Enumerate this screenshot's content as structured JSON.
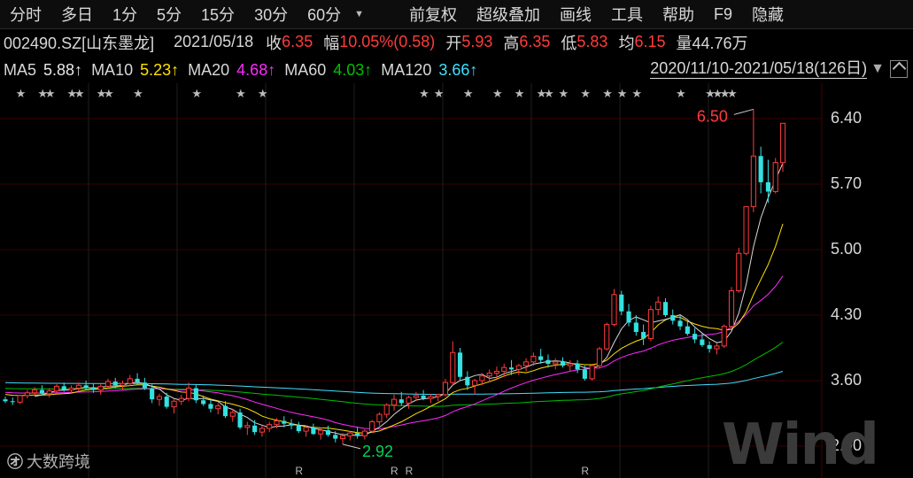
{
  "toolbar": {
    "items": [
      "分时",
      "多日",
      "1分",
      "5分",
      "15分",
      "30分",
      "60分"
    ],
    "arrow": "▼",
    "right_items": [
      "前复权",
      "超级叠加",
      "画线",
      "工具",
      "帮助",
      "F9",
      "隐藏"
    ]
  },
  "quote": {
    "code": "002490.SZ[山东墨龙]",
    "date": "2021/05/18",
    "close_label": "收",
    "close": "6.35",
    "change_label": "幅",
    "change_pct": "10.05%",
    "change_abs": "(0.58)",
    "open_label": "开",
    "open": "5.93",
    "high_label": "高",
    "high": "6.35",
    "low_label": "低",
    "low": "5.83",
    "avg_label": "均",
    "avg": "6.15",
    "vol_label": "量",
    "vol": "44.76万"
  },
  "ma": {
    "ma5_label": "MA5",
    "ma5": "5.88↑",
    "ma10_label": "MA10",
    "ma10": "5.23↑",
    "ma20_label": "MA20",
    "ma20": "4.68↑",
    "ma60_label": "MA60",
    "ma60": "4.03↑",
    "ma120_label": "MA120",
    "ma120": "3.66↑"
  },
  "range": "2020/11/10-2021/05/18(126日)",
  "range_arrow": "▼",
  "colors": {
    "up": "#ff3b3b",
    "down": "#34e0e0",
    "ma5": "#d8d8d8",
    "ma10": "#ffe000",
    "ma20": "#ff2aff",
    "ma60": "#00c000",
    "ma120": "#40e0ff"
  },
  "logo": {
    "mark": "㋔",
    "text": "大数跨境"
  },
  "watermark": "Wind",
  "chart_data": {
    "type": "candlestick",
    "yticks": [
      "6.40",
      "5.70",
      "5.00",
      "4.30",
      "3.60",
      "2.90"
    ],
    "ylim": [
      2.9,
      6.4
    ],
    "annotations": {
      "max": "6.50",
      "min": "2.92"
    },
    "markers": {
      "star": "★",
      "r": "R"
    },
    "ohlc": [
      [
        3.4,
        3.43,
        3.36,
        3.38
      ],
      [
        3.38,
        3.42,
        3.34,
        3.37
      ],
      [
        3.37,
        3.45,
        3.35,
        3.44
      ],
      [
        3.44,
        3.5,
        3.41,
        3.47
      ],
      [
        3.47,
        3.53,
        3.44,
        3.5
      ],
      [
        3.5,
        3.55,
        3.44,
        3.46
      ],
      [
        3.46,
        3.52,
        3.42,
        3.49
      ],
      [
        3.49,
        3.56,
        3.46,
        3.54
      ],
      [
        3.54,
        3.58,
        3.48,
        3.5
      ],
      [
        3.5,
        3.55,
        3.46,
        3.52
      ],
      [
        3.52,
        3.58,
        3.48,
        3.55
      ],
      [
        3.55,
        3.6,
        3.5,
        3.53
      ],
      [
        3.53,
        3.57,
        3.47,
        3.5
      ],
      [
        3.5,
        3.56,
        3.45,
        3.54
      ],
      [
        3.54,
        3.62,
        3.51,
        3.59
      ],
      [
        3.59,
        3.63,
        3.52,
        3.55
      ],
      [
        3.55,
        3.6,
        3.5,
        3.57
      ],
      [
        3.57,
        3.66,
        3.54,
        3.62
      ],
      [
        3.62,
        3.68,
        3.55,
        3.58
      ],
      [
        3.58,
        3.63,
        3.5,
        3.52
      ],
      [
        3.52,
        3.56,
        3.36,
        3.4
      ],
      [
        3.4,
        3.46,
        3.33,
        3.43
      ],
      [
        3.43,
        3.47,
        3.3,
        3.32
      ],
      [
        3.32,
        3.4,
        3.25,
        3.38
      ],
      [
        3.38,
        3.45,
        3.34,
        3.41
      ],
      [
        3.41,
        3.58,
        3.38,
        3.52
      ],
      [
        3.52,
        3.56,
        3.36,
        3.39
      ],
      [
        3.39,
        3.44,
        3.33,
        3.35
      ],
      [
        3.35,
        3.4,
        3.26,
        3.3
      ],
      [
        3.3,
        3.36,
        3.24,
        3.33
      ],
      [
        3.33,
        3.38,
        3.2,
        3.22
      ],
      [
        3.22,
        3.3,
        3.16,
        3.26
      ],
      [
        3.26,
        3.3,
        3.08,
        3.1
      ],
      [
        3.1,
        3.16,
        3.02,
        3.12
      ],
      [
        3.12,
        3.18,
        3.02,
        3.05
      ],
      [
        3.05,
        3.12,
        3.0,
        3.09
      ],
      [
        3.09,
        3.16,
        3.05,
        3.13
      ],
      [
        3.13,
        3.2,
        3.09,
        3.17
      ],
      [
        3.17,
        3.22,
        3.1,
        3.14
      ],
      [
        3.14,
        3.19,
        3.08,
        3.12
      ],
      [
        3.12,
        3.16,
        3.04,
        3.06
      ],
      [
        3.06,
        3.12,
        3.0,
        3.1
      ],
      [
        3.1,
        3.14,
        3.02,
        3.03
      ],
      [
        3.03,
        3.1,
        2.97,
        3.07
      ],
      [
        3.07,
        3.12,
        3.0,
        3.02
      ],
      [
        3.02,
        3.06,
        2.94,
        2.98
      ],
      [
        2.98,
        3.04,
        2.92,
        3.01
      ],
      [
        3.01,
        3.06,
        2.96,
        3.04
      ],
      [
        3.04,
        3.1,
        2.98,
        3.01
      ],
      [
        3.01,
        3.08,
        2.97,
        3.06
      ],
      [
        3.06,
        3.18,
        3.04,
        3.16
      ],
      [
        3.16,
        3.26,
        3.12,
        3.24
      ],
      [
        3.24,
        3.36,
        3.2,
        3.34
      ],
      [
        3.34,
        3.45,
        3.28,
        3.4
      ],
      [
        3.4,
        3.48,
        3.33,
        3.36
      ],
      [
        3.36,
        3.44,
        3.3,
        3.42
      ],
      [
        3.42,
        3.48,
        3.38,
        3.44
      ],
      [
        3.44,
        3.5,
        3.39,
        3.41
      ],
      [
        3.41,
        3.46,
        3.36,
        3.43
      ],
      [
        3.43,
        3.46,
        3.38,
        3.45
      ],
      [
        3.45,
        3.62,
        3.43,
        3.58
      ],
      [
        3.58,
        4.02,
        3.55,
        3.9
      ],
      [
        3.9,
        3.95,
        3.6,
        3.64
      ],
      [
        3.64,
        3.7,
        3.5,
        3.55
      ],
      [
        3.55,
        3.62,
        3.45,
        3.6
      ],
      [
        3.6,
        3.68,
        3.55,
        3.65
      ],
      [
        3.65,
        3.72,
        3.58,
        3.68
      ],
      [
        3.68,
        3.75,
        3.62,
        3.7
      ],
      [
        3.7,
        3.78,
        3.64,
        3.74
      ],
      [
        3.74,
        3.82,
        3.66,
        3.72
      ],
      [
        3.72,
        3.78,
        3.66,
        3.76
      ],
      [
        3.76,
        3.84,
        3.7,
        3.8
      ],
      [
        3.8,
        3.9,
        3.76,
        3.86
      ],
      [
        3.86,
        3.94,
        3.78,
        3.82
      ],
      [
        3.82,
        3.88,
        3.74,
        3.78
      ],
      [
        3.78,
        3.84,
        3.72,
        3.8
      ],
      [
        3.8,
        3.85,
        3.74,
        3.76
      ],
      [
        3.76,
        3.82,
        3.7,
        3.78
      ],
      [
        3.78,
        3.82,
        3.68,
        3.72
      ],
      [
        3.72,
        3.76,
        3.6,
        3.62
      ],
      [
        3.62,
        3.78,
        3.6,
        3.76
      ],
      [
        3.76,
        3.96,
        3.74,
        3.94
      ],
      [
        3.94,
        4.22,
        3.92,
        4.2
      ],
      [
        4.2,
        4.58,
        4.18,
        4.52
      ],
      [
        4.52,
        4.56,
        4.3,
        4.34
      ],
      [
        4.34,
        4.42,
        4.18,
        4.22
      ],
      [
        4.22,
        4.3,
        4.08,
        4.12
      ],
      [
        4.12,
        4.2,
        3.98,
        4.05
      ],
      [
        4.05,
        4.4,
        4.02,
        4.36
      ],
      [
        4.36,
        4.5,
        4.3,
        4.44
      ],
      [
        4.44,
        4.48,
        4.28,
        4.3
      ],
      [
        4.3,
        4.36,
        4.2,
        4.24
      ],
      [
        4.24,
        4.3,
        4.14,
        4.18
      ],
      [
        4.18,
        4.24,
        4.08,
        4.1
      ],
      [
        4.1,
        4.16,
        4.0,
        4.04
      ],
      [
        4.04,
        4.1,
        3.96,
        3.98
      ],
      [
        3.98,
        4.02,
        3.9,
        3.94
      ],
      [
        3.94,
        4.0,
        3.88,
        3.97
      ],
      [
        3.97,
        4.2,
        3.95,
        4.18
      ],
      [
        4.18,
        4.6,
        4.16,
        4.56
      ],
      [
        4.56,
        5.02,
        4.54,
        4.96
      ],
      [
        4.96,
        5.46,
        4.94,
        5.46
      ],
      [
        5.46,
        6.5,
        5.4,
        6.0
      ],
      [
        6.0,
        6.1,
        5.6,
        5.72
      ],
      [
        5.72,
        5.96,
        5.5,
        5.62
      ],
      [
        5.62,
        5.98,
        5.6,
        5.93
      ],
      [
        5.93,
        6.35,
        5.83,
        6.35
      ]
    ],
    "ma5": [],
    "ma10": [],
    "ma20": [],
    "ma60": [],
    "ma120": []
  }
}
